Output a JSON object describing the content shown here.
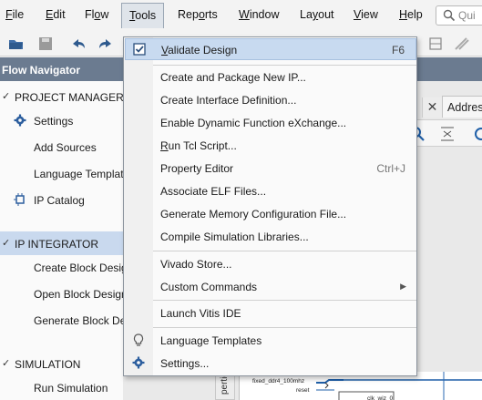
{
  "menubar": {
    "items": [
      {
        "label": "File",
        "u": "F",
        "rest": "ile"
      },
      {
        "label": "Edit",
        "u": "E",
        "rest": "dit"
      },
      {
        "label": "Flow",
        "pre": "Fl",
        "u": "o",
        "rest": "w"
      },
      {
        "label": "Tools",
        "u": "T",
        "rest": "ools"
      },
      {
        "label": "Reports",
        "pre": "Rep",
        "u": "o",
        "rest": "rts"
      },
      {
        "label": "Window",
        "u": "W",
        "rest": "indow"
      },
      {
        "label": "Layout",
        "pre": "La",
        "u": "y",
        "rest": "out"
      },
      {
        "label": "View",
        "u": "V",
        "rest": "iew"
      },
      {
        "label": "Help",
        "u": "H",
        "rest": "elp"
      }
    ],
    "search_text": "Qui"
  },
  "flow_navigator": {
    "title": "Flow Navigator",
    "project_manager": "PROJECT MANAGER",
    "settings": "Settings",
    "add_sources": "Add Sources",
    "language_templates": "Language Templates",
    "ip_catalog": "IP Catalog",
    "ip_integrator": "IP INTEGRATOR",
    "create_block_design": "Create Block Design",
    "open_block_design": "Open Block Design",
    "generate_block_design": "Generate Block Design",
    "simulation": "SIMULATION",
    "run_simulation": "Run Simulation"
  },
  "workspace": {
    "tab_close": "✕",
    "address_tab": "Address",
    "side_tab": "pertie",
    "diagram_labels": [
      "fixed_ddr4_100mhz",
      "reset",
      "clk_wiz_0"
    ]
  },
  "tools_menu": {
    "items": [
      {
        "label": "Validate Design",
        "underline": "V",
        "rest": "alidate Design",
        "shortcut": "F6",
        "icon": "validate-checkbox-icon",
        "highlighted": true
      },
      {
        "label": "Create and Package New IP...",
        "shortcut": ""
      },
      {
        "label": "Create Interface Definition...",
        "shortcut": ""
      },
      {
        "label": "Enable Dynamic Function eXchange...",
        "shortcut": ""
      },
      {
        "label": "Run Tcl Script...",
        "underline": "R",
        "rest": "un Tcl Script...",
        "shortcut": ""
      },
      {
        "label": "Property Editor",
        "shortcut": "Ctrl+J"
      },
      {
        "label": "Associate ELF Files...",
        "shortcut": ""
      },
      {
        "label": "Generate Memory Configuration File...",
        "shortcut": ""
      },
      {
        "label": "Compile Simulation Libraries...",
        "shortcut": ""
      },
      {
        "label": "Vivado Store...",
        "shortcut": ""
      },
      {
        "label": "Custom Commands",
        "shortcut": "",
        "submenu": true
      },
      {
        "label": "Launch Vitis IDE",
        "shortcut": ""
      },
      {
        "label": "Language Templates",
        "shortcut": "",
        "icon": "lightbulb-icon"
      },
      {
        "label": "Settings...",
        "shortcut": "",
        "icon": "gear-icon"
      }
    ]
  },
  "colors": {
    "flow_header_bg": "#6b7b90",
    "selection_bg": "#c9d9ee",
    "menu_highlight": "#c8daf0"
  }
}
